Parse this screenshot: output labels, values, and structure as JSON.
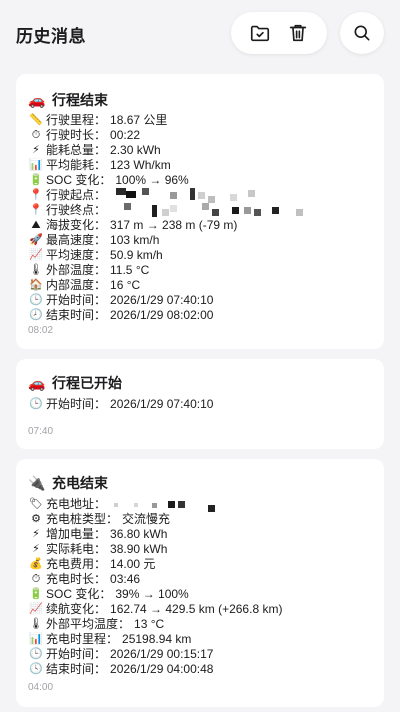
{
  "header": {
    "title": "历史消息"
  },
  "toolbar": {
    "export_icon": "folder-check-icon",
    "delete_icon": "trash-icon",
    "search_icon": "search-icon"
  },
  "cards": [
    {
      "icon": "🚗",
      "title": "行程结束",
      "rows": [
        {
          "icon": "📏",
          "label": "行驶里程：",
          "value": "18.67 公里"
        },
        {
          "icon": "⏱",
          "label": "行驶时长：",
          "value": "00:22"
        },
        {
          "icon": "⚡",
          "label": "能耗总量：",
          "value": "2.30 kWh"
        },
        {
          "icon": "📊",
          "label": "平均能耗：",
          "value": "123 Wh/km"
        },
        {
          "icon": "🔋",
          "label": "SOC 变化：",
          "value": "100% → 96%"
        },
        {
          "icon": "📍",
          "label": "行驶起点：",
          "value": ""
        },
        {
          "icon": "📍",
          "label": "行驶终点：",
          "value": ""
        },
        {
          "icon": "⛰",
          "label": "海拔变化：",
          "value": "317 m → 238 m (-79 m)"
        },
        {
          "icon": "🚀",
          "label": "最高速度：",
          "value": "103 km/h"
        },
        {
          "icon": "📈",
          "label": "平均速度：",
          "value": "50.9 km/h"
        },
        {
          "icon": "🌡",
          "label": "外部温度：",
          "value": "11.5 °C"
        },
        {
          "icon": "🏠",
          "label": "内部温度：",
          "value": "16 °C"
        },
        {
          "icon": "🕒",
          "label": "开始时间：",
          "value": "2026/1/29 07:40:10"
        },
        {
          "icon": "🕗",
          "label": "结束时间：",
          "value": "2026/1/29 08:02:00"
        }
      ],
      "time": "08:02"
    },
    {
      "icon": "🚗",
      "title": "行程已开始",
      "rows": [
        {
          "icon": "🕒",
          "label": "开始时间：",
          "value": "2026/1/29 07:40:10"
        }
      ],
      "time": "07:40"
    },
    {
      "icon": "🔌",
      "title": "充电结束",
      "rows": [
        {
          "icon": "🏷",
          "label": "充电地址：",
          "value": ""
        },
        {
          "icon": "⚙",
          "label": "充电桩类型：",
          "value": "交流慢充"
        },
        {
          "icon": "⚡",
          "label": "增加电量：",
          "value": "36.80 kWh"
        },
        {
          "icon": "⚡",
          "label": "实际耗电：",
          "value": "38.90 kWh"
        },
        {
          "icon": "💰",
          "label": "充电费用：",
          "value": "14.00 元"
        },
        {
          "icon": "⏱",
          "label": "充电时长：",
          "value": "03:46"
        },
        {
          "icon": "🔋",
          "label": "SOC 变化：",
          "value": "39% → 100%"
        },
        {
          "icon": "📈",
          "label": "续航变化：",
          "value": "162.74 → 429.5 km (+266.8 km)"
        },
        {
          "icon": "🌡",
          "label": "外部平均温度：",
          "value": "13 °C"
        },
        {
          "icon": "📊",
          "label": "充电时里程：",
          "value": "25198.94 km"
        },
        {
          "icon": "🕒",
          "label": "开始时间：",
          "value": "2026/1/29 00:15:17"
        },
        {
          "icon": "🕓",
          "label": "结束时间：",
          "value": "2026/1/29 04:00:48"
        }
      ],
      "time": "04:00"
    }
  ]
}
